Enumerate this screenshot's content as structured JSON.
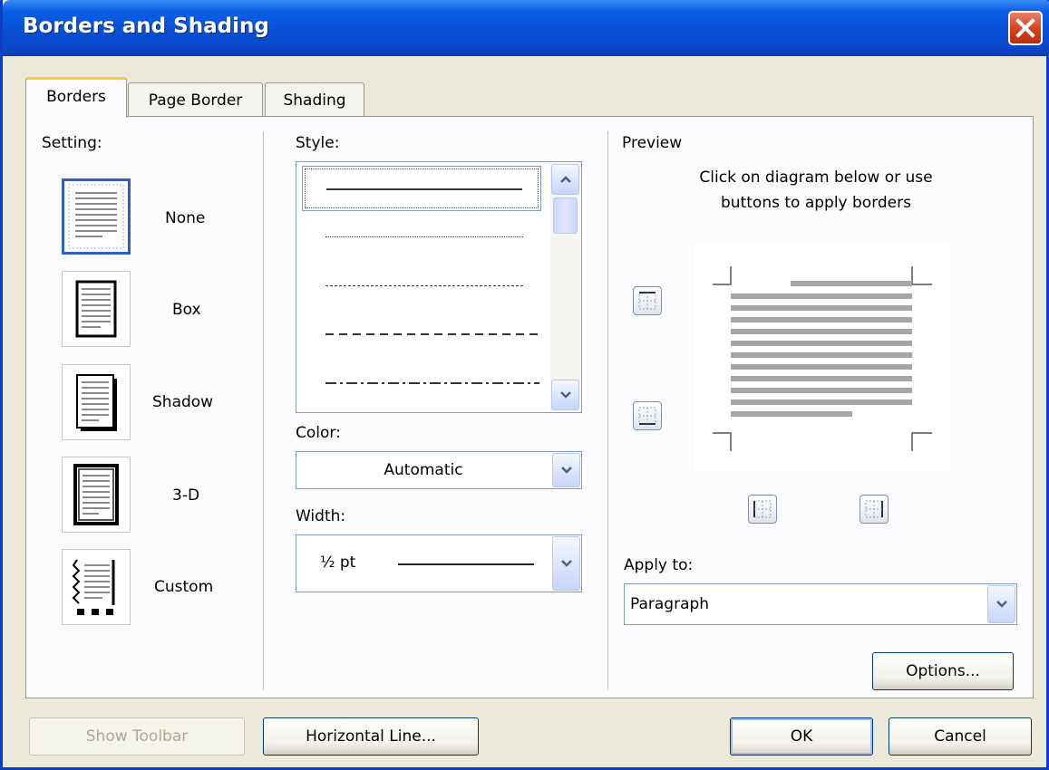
{
  "dialog": {
    "title": "Borders and Shading"
  },
  "tabs": [
    {
      "label": "Borders",
      "active": true
    },
    {
      "label": "Page Border",
      "active": false
    },
    {
      "label": "Shading",
      "active": false
    }
  ],
  "setting": {
    "heading": "Setting:",
    "options": [
      {
        "label": "None",
        "selected": true
      },
      {
        "label": "Box",
        "selected": false
      },
      {
        "label": "Shadow",
        "selected": false
      },
      {
        "label": "3-D",
        "selected": false
      },
      {
        "label": "Custom",
        "selected": false
      }
    ]
  },
  "style": {
    "heading": "Style:",
    "options": [
      "solid",
      "dotted",
      "fine-dashed",
      "dashed",
      "dash-dot"
    ],
    "selected_index": 0
  },
  "color": {
    "heading": "Color:",
    "value": "Automatic"
  },
  "width": {
    "heading": "Width:",
    "value": "½ pt"
  },
  "preview": {
    "heading": "Preview",
    "instruction_line1": "Click on diagram below or use",
    "instruction_line2": "buttons to apply borders"
  },
  "apply_to": {
    "heading": "Apply to:",
    "value": "Paragraph"
  },
  "buttons": {
    "options": "Options...",
    "show_toolbar": "Show Toolbar",
    "horizontal_line": "Horizontal Line...",
    "ok": "OK",
    "cancel": "Cancel"
  },
  "colors": {
    "titlebar": "#0a4fd6",
    "accent_tab": "#ffc83c",
    "dialog_bg": "#ece9d8",
    "close": "#d43b14"
  }
}
